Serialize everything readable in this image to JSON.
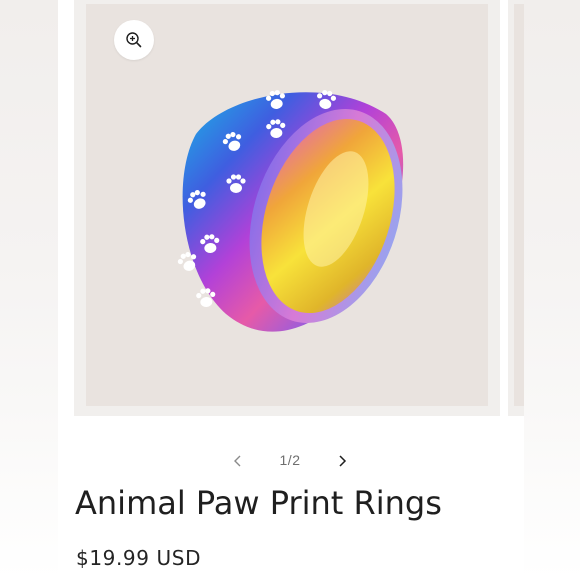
{
  "gallery": {
    "zoom_icon": "zoom-in-icon",
    "image_subject": "rainbow paw print ring",
    "pagination": {
      "current": 1,
      "total": 2,
      "counter_text": "1/2",
      "prev_icon": "chevron-left-icon",
      "next_icon": "chevron-right-icon"
    }
  },
  "product": {
    "title": "Animal Paw Print Rings",
    "price": "$19.99 USD"
  },
  "colors": {
    "text": "#1f1f1f",
    "muted": "#6e6e6e",
    "image_bg": "#e9e3df"
  }
}
